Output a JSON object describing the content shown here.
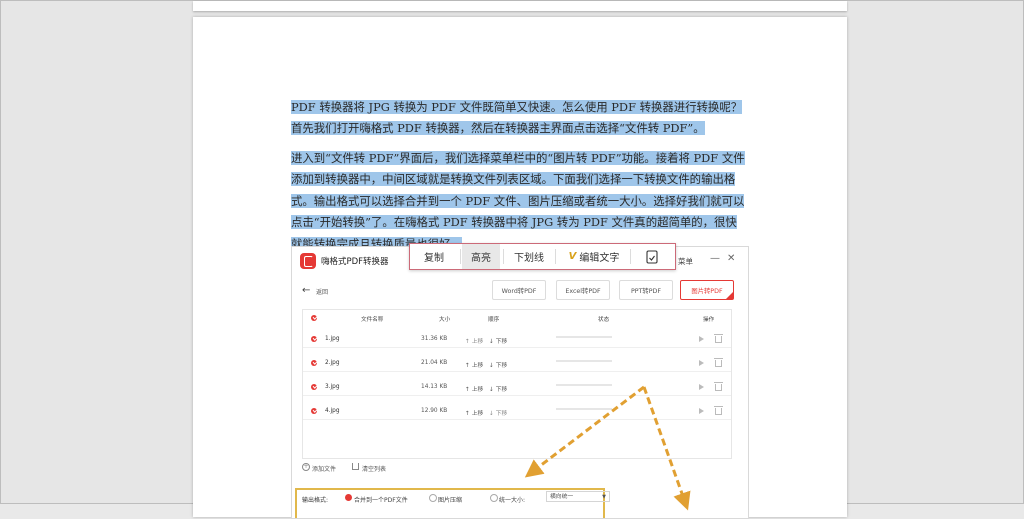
{
  "document": {
    "paragraph1": "PDF 转换器将 JPG 转换为 PDF 文件既简单又快速。怎么使用 PDF 转换器进行转换呢？首先我们打开嗨格式 PDF 转换器，然后在转换器主界面点击选择“文件转 PDF”。",
    "paragraph2": "进入到“文件转 PDF”界面后，我们选择菜单栏中的“图片转 PDF”功能。接着将 PDF 文件添加到转换器中，中间区域就是转换文件列表区域。下面我们选择一下转换文件的输出格式。输出格式可以选择合并到一个 PDF 文件、图片压缩或者统一大小。选择好我们就可以点击“开始转换”了。在嗨格式 PDF 转换器中将 JPG 转为 PDF 文件真的超简单的，很快就能转换完成且转换质量也很好。"
  },
  "popup_toolbar": {
    "copy": "复制",
    "highlight": "高亮",
    "underline": "下划线",
    "vip_badge": "V",
    "edit_text": "编辑文字",
    "ocr_icon": "text-recognition-icon"
  },
  "screenshot": {
    "app_title": "嗨格式PDF转换器",
    "menu": "菜单",
    "window_min": "—",
    "window_close": "✕",
    "back_label": "返回",
    "tools": {
      "word": "Word转PDF",
      "excel": "Excel转PDF",
      "ppt": "PPT转PDF",
      "image": "图片转PDF"
    },
    "columns": {
      "name": "文件名称",
      "size": "大小",
      "order": "顺序",
      "status": "状态",
      "action": "操作"
    },
    "rows": [
      {
        "name": "1.jpg",
        "size": "31.36 KB",
        "up": "↑ 上移",
        "down": "↓ 下移"
      },
      {
        "name": "2.jpg",
        "size": "21.04 KB",
        "up": "↑ 上移",
        "down": "↓ 下移"
      },
      {
        "name": "3.jpg",
        "size": "14.13 KB",
        "up": "↑ 上移",
        "down": "↓ 下移"
      },
      {
        "name": "4.jpg",
        "size": "12.90 KB",
        "up": "↑ 上移",
        "down": "↓ 下移"
      }
    ],
    "add_file": "添加文件",
    "clear_list": "清空列表",
    "output_label": "输出格式:",
    "opt_merge": "合并到一个PDF文件",
    "opt_compress": "图片压缩",
    "opt_size": "统一大小:",
    "size_select": "横向统一",
    "accent_color": "#e53935",
    "arrow_color": "#e1a032"
  }
}
